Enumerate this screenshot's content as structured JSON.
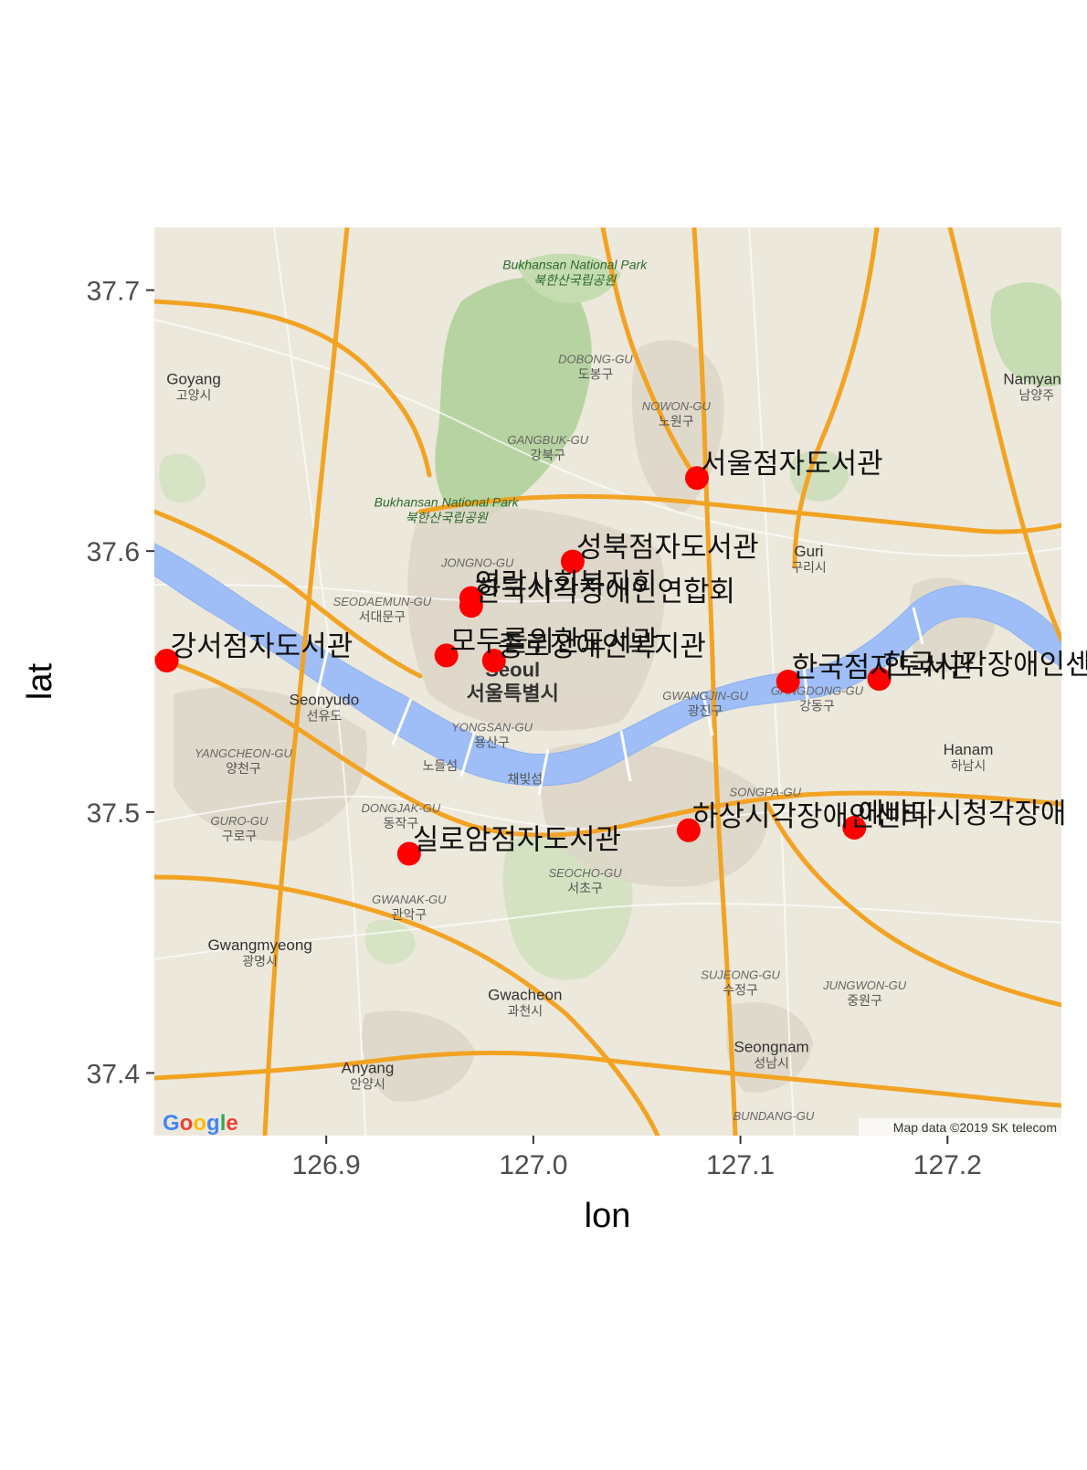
{
  "chart_data": {
    "type": "scatter",
    "xlabel": "lon",
    "ylabel": "lat",
    "xlim": [
      126.817,
      127.255
    ],
    "ylim": [
      37.376,
      37.724
    ],
    "xticks": [
      126.9,
      127.0,
      127.1,
      127.2
    ],
    "xtick_labels": [
      "126.9",
      "127.0",
      "127.1",
      "127.2"
    ],
    "yticks": [
      37.4,
      37.5,
      37.6,
      37.7
    ],
    "ytick_labels": [
      "37.4",
      "37.5",
      "37.6",
      "37.7"
    ],
    "point_color": "#ff0000",
    "points": [
      {
        "label": "서울점자도서관",
        "lon": 127.079,
        "lat": 37.628
      },
      {
        "label": "성북점자도서관",
        "lon": 127.019,
        "lat": 37.596
      },
      {
        "label": "영락사회복지회",
        "lon": 126.97,
        "lat": 37.582
      },
      {
        "label": "한국시각장애인연합회",
        "lon": 126.97,
        "lat": 37.579
      },
      {
        "label": "강서점자도서관",
        "lon": 126.823,
        "lat": 37.558
      },
      {
        "label": "모두를위한도서관",
        "lon": 126.958,
        "lat": 37.56
      },
      {
        "label": "종로장애인복지관",
        "lon": 126.981,
        "lat": 37.558
      },
      {
        "label": "한국점자도서관",
        "lon": 127.123,
        "lat": 37.55
      },
      {
        "label": "한국시각장애인센터",
        "lon": 127.167,
        "lat": 37.551
      },
      {
        "label": "실로암점자도서관",
        "lon": 126.94,
        "lat": 37.484
      },
      {
        "label": "하상시각장애인센터",
        "lon": 127.075,
        "lat": 37.493
      },
      {
        "label": "에바다시청각장애",
        "lon": 127.155,
        "lat": 37.494
      }
    ]
  },
  "map": {
    "attribution": "Map data ©2019 SK telecom",
    "logo": "Google",
    "places": [
      {
        "name": "Bukhansan National Park",
        "ko": "북한산국립공원",
        "kind": "park",
        "lon": 127.02,
        "lat": 37.708
      },
      {
        "name": "Bukhansan National Park",
        "ko": "북한산국립공원",
        "kind": "park",
        "lon": 126.958,
        "lat": 37.617
      },
      {
        "name": "Goyang",
        "ko": "고양시",
        "kind": "city",
        "lon": 126.836,
        "lat": 37.664
      },
      {
        "name": "DOBONG-GU",
        "ko": "도봉구",
        "kind": "dist",
        "lon": 127.03,
        "lat": 37.672
      },
      {
        "name": "NOWON-GU",
        "ko": "노원구",
        "kind": "dist",
        "lon": 127.069,
        "lat": 37.654
      },
      {
        "name": "GANGBUK-GU",
        "ko": "강북구",
        "kind": "dist",
        "lon": 127.007,
        "lat": 37.641
      },
      {
        "name": "Namyang",
        "ko": "남양주",
        "kind": "city",
        "lon": 127.243,
        "lat": 37.664
      },
      {
        "name": "JONGNO-GU",
        "ko": "",
        "kind": "dist",
        "lon": 126.973,
        "lat": 37.594
      },
      {
        "name": "SEODAEMUN-GU",
        "ko": "서대문구",
        "kind": "dist",
        "lon": 126.927,
        "lat": 37.579
      },
      {
        "name": "Guri",
        "ko": "구리시",
        "kind": "city",
        "lon": 127.133,
        "lat": 37.598
      },
      {
        "name": "GWANGJIN-GU",
        "ko": "광진구",
        "kind": "dist",
        "lon": 127.083,
        "lat": 37.543
      },
      {
        "name": "GANGDONG-GU",
        "ko": "강동구",
        "kind": "dist",
        "lon": 127.137,
        "lat": 37.545
      },
      {
        "name": "Seonyudo",
        "ko": "선유도",
        "kind": "city",
        "lon": 126.899,
        "lat": 37.541
      },
      {
        "name": "YONGSAN-GU",
        "ko": "용산구",
        "kind": "dist",
        "lon": 126.98,
        "lat": 37.531
      },
      {
        "name": "YANGCHEON-GU",
        "ko": "양천구",
        "kind": "dist",
        "lon": 126.86,
        "lat": 37.521
      },
      {
        "name": "노들섬",
        "ko": "",
        "kind": "small",
        "lon": 126.955,
        "lat": 37.516
      },
      {
        "name": "채빛섬",
        "ko": "",
        "kind": "small",
        "lon": 126.996,
        "lat": 37.511
      },
      {
        "name": "Hanam",
        "ko": "하남시",
        "kind": "city",
        "lon": 127.21,
        "lat": 37.522
      },
      {
        "name": "SONGPA-GU",
        "ko": "",
        "kind": "dist",
        "lon": 127.112,
        "lat": 37.506
      },
      {
        "name": "DONGJAK-GU",
        "ko": "동작구",
        "kind": "dist",
        "lon": 126.936,
        "lat": 37.5
      },
      {
        "name": "GURO-GU",
        "ko": "구로구",
        "kind": "dist",
        "lon": 126.858,
        "lat": 37.495
      },
      {
        "name": "SEOCHO-GU",
        "ko": "서초구",
        "kind": "dist",
        "lon": 127.025,
        "lat": 37.475
      },
      {
        "name": "GWANAK-GU",
        "ko": "관악구",
        "kind": "dist",
        "lon": 126.94,
        "lat": 37.465
      },
      {
        "name": "Gwangmyeong",
        "ko": "광명시",
        "kind": "city",
        "lon": 126.868,
        "lat": 37.447
      },
      {
        "name": "Gwacheon",
        "ko": "과천시",
        "kind": "city",
        "lon": 126.996,
        "lat": 37.428
      },
      {
        "name": "SUJEONG-GU",
        "ko": "수정구",
        "kind": "dist",
        "lon": 127.1,
        "lat": 37.436
      },
      {
        "name": "JUNGWON-GU",
        "ko": "중원구",
        "kind": "dist",
        "lon": 127.16,
        "lat": 37.432
      },
      {
        "name": "Seongnam",
        "ko": "성남시",
        "kind": "city",
        "lon": 127.115,
        "lat": 37.408
      },
      {
        "name": "Anyang",
        "ko": "안양시",
        "kind": "city",
        "lon": 126.92,
        "lat": 37.4
      },
      {
        "name": "BUNDANG-GU",
        "ko": "",
        "kind": "dist",
        "lon": 127.116,
        "lat": 37.382
      }
    ],
    "seoul_label": {
      "name": "Seoul",
      "ko": "서울특별시",
      "lon": 126.99,
      "lat": 37.552
    }
  }
}
